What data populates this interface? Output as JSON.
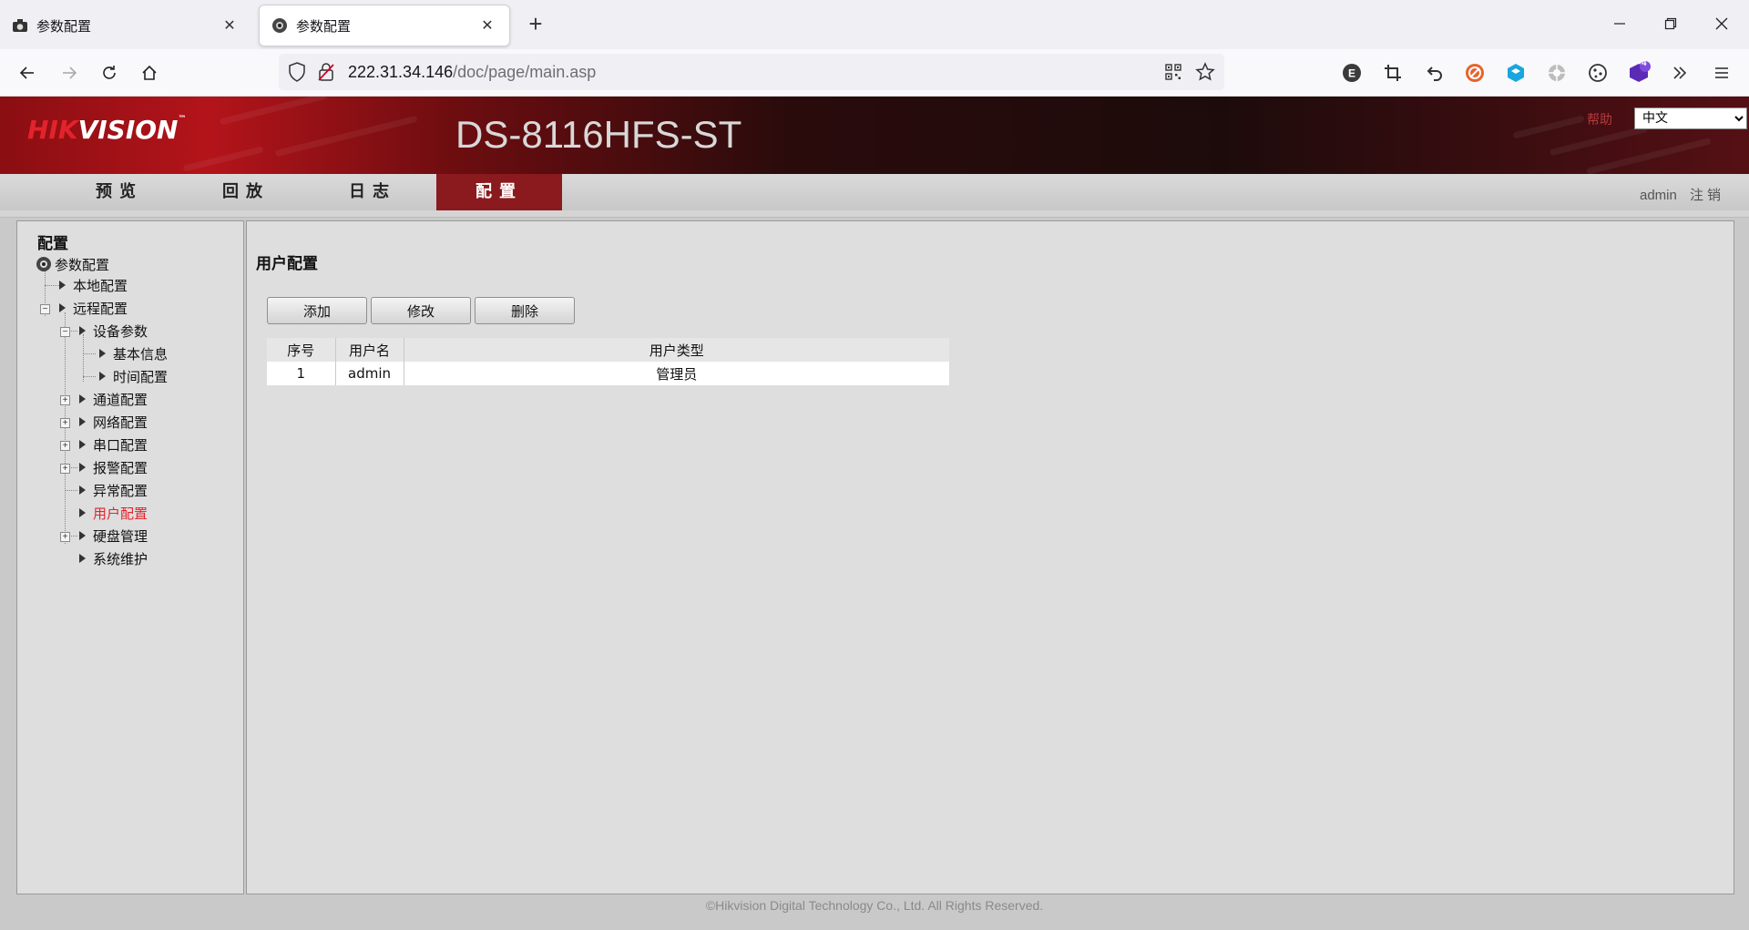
{
  "browser": {
    "tabs": [
      {
        "label": "参数配置",
        "icon": "camera-icon"
      },
      {
        "label": "参数配置",
        "icon": "camera-icon"
      }
    ],
    "new_tab": "+",
    "url_host": "222.31.34.146",
    "url_path": "/doc/page/main.asp",
    "extension_badge": "4"
  },
  "header": {
    "logo_red": "HIK",
    "logo_white": "VISION",
    "logo_tm": "™",
    "model": "DS-8116HFS-ST",
    "help": "帮助",
    "language": "中文"
  },
  "mainnav": {
    "items": [
      "预览",
      "回放",
      "日志",
      "配置"
    ],
    "active": "配置",
    "user": "admin",
    "logout": "注销"
  },
  "sidebar": {
    "title": "配置",
    "root": "参数配置",
    "local": "本地配置",
    "remote": "远程配置",
    "device_params": "设备参数",
    "basic_info": "基本信息",
    "time_config": "时间配置",
    "channel": "通道配置",
    "network": "网络配置",
    "serial": "串口配置",
    "alarm": "报警配置",
    "exception": "异常配置",
    "user": "用户配置",
    "disk": "硬盘管理",
    "maintenance": "系统维护"
  },
  "main": {
    "title": "用户配置",
    "buttons": {
      "add": "添加",
      "modify": "修改",
      "delete": "删除"
    },
    "table": {
      "headers": [
        "序号",
        "用户名",
        "用户类型"
      ],
      "rows": [
        [
          "1",
          "admin",
          "管理员"
        ]
      ]
    }
  },
  "footer": "©Hikvision Digital Technology Co., Ltd. All Rights Reserved."
}
